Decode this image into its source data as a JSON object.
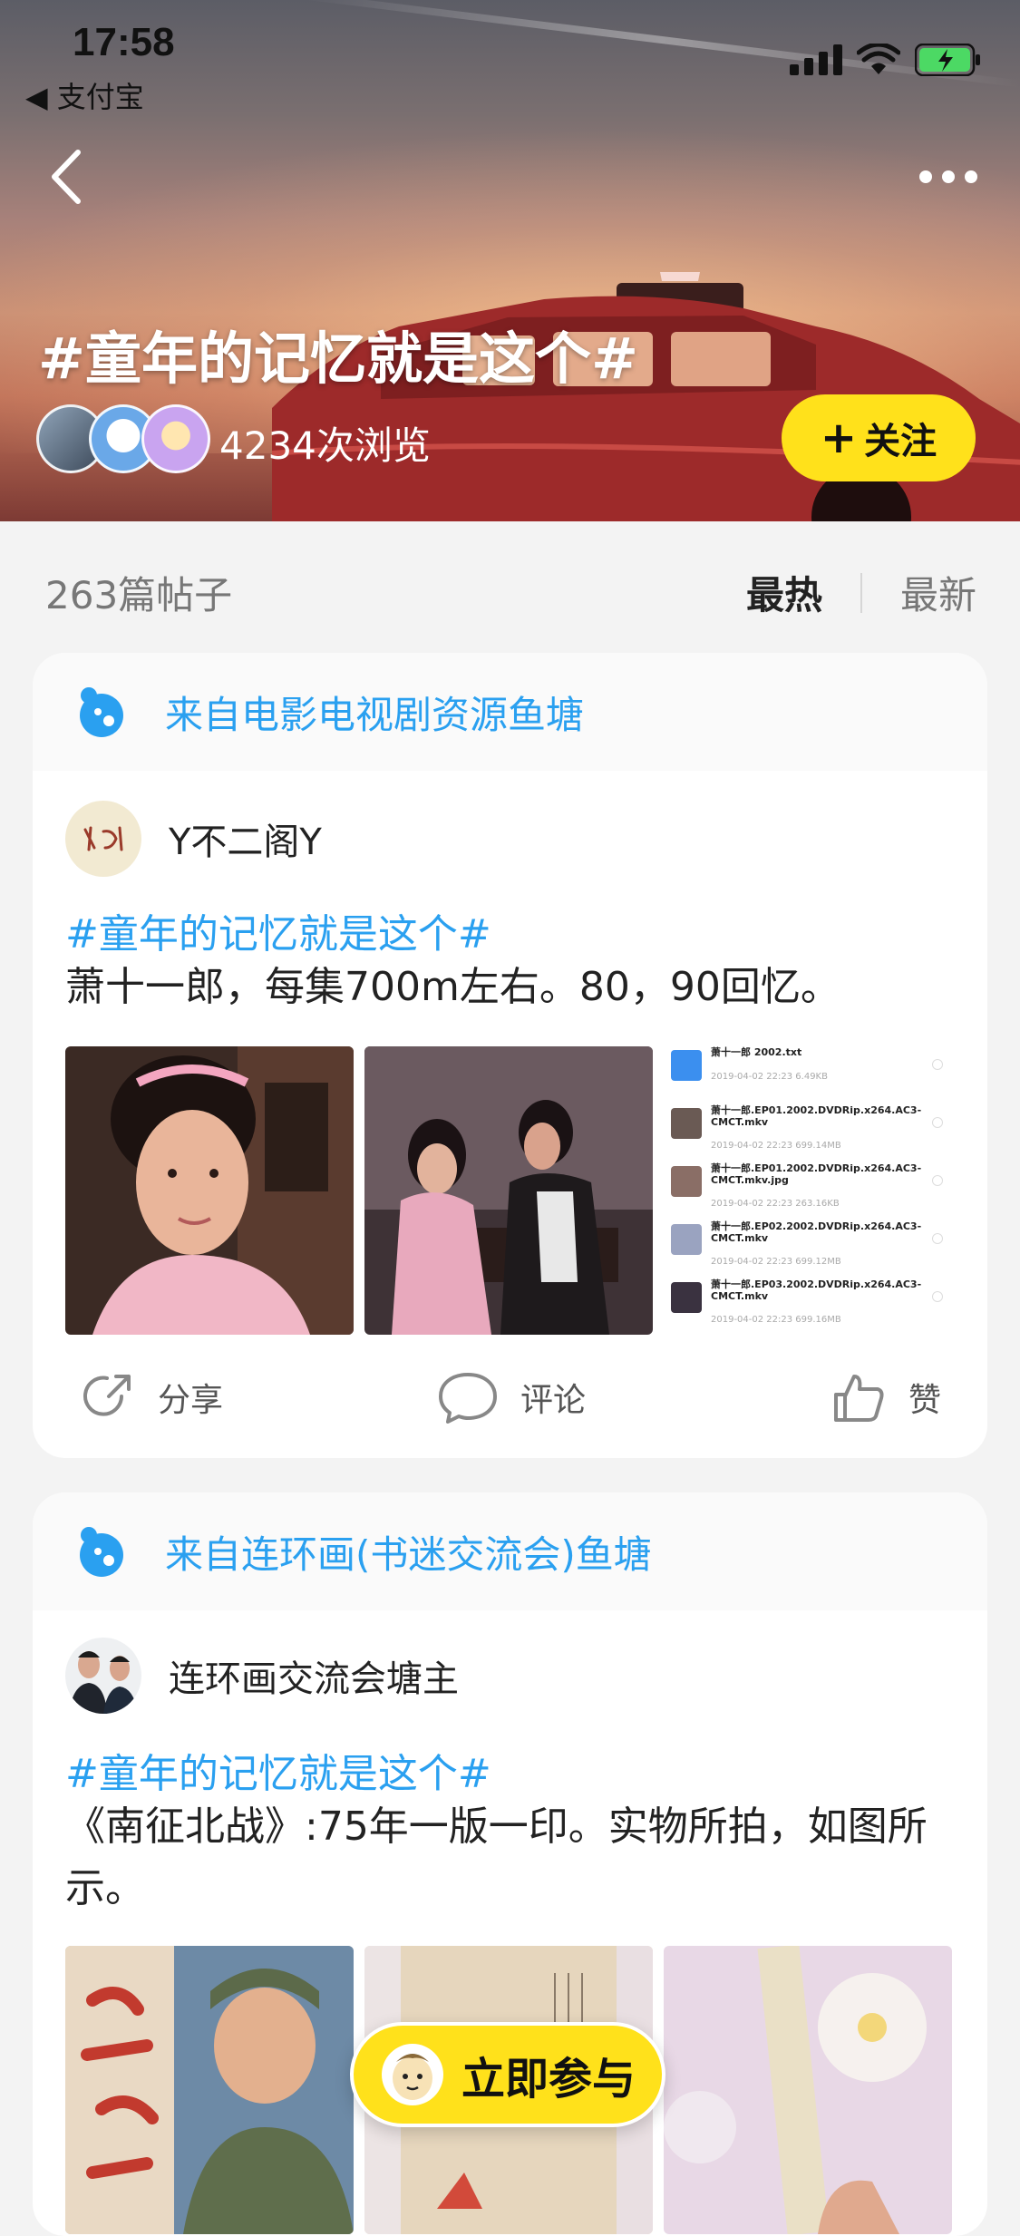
{
  "status_bar": {
    "time": "17:58",
    "back_app": "◀ 支付宝"
  },
  "header": {
    "title": "#童年的记忆就是这个#",
    "views": "4234次浏览",
    "follow_label": "关注"
  },
  "sort_bar": {
    "post_count": "263篇帖子",
    "hot": "最热",
    "newest": "最新"
  },
  "posts": [
    {
      "source": "来自电影电视剧资源鱼塘",
      "author": "Y不二阁Y",
      "hashtag": "#童年的记忆就是这个#",
      "text": "萧十一郎，每集700m左右。80，90回忆。",
      "files": [
        {
          "name": "萧十一郎 2002.txt",
          "meta": "2019-04-02  22:23  6.49KB"
        },
        {
          "name": "萧十一郎.EP01.2002.DVDRip.x264.AC3-CMCT.mkv",
          "meta": "2019-04-02  22:23  699.14MB"
        },
        {
          "name": "萧十一郎.EP01.2002.DVDRip.x264.AC3-CMCT.mkv.jpg",
          "meta": "2019-04-02  22:23  263.16KB"
        },
        {
          "name": "萧十一郎.EP02.2002.DVDRip.x264.AC3-CMCT.mkv",
          "meta": "2019-04-02  22:23  699.12MB"
        },
        {
          "name": "萧十一郎.EP03.2002.DVDRip.x264.AC3-CMCT.mkv",
          "meta": "2019-04-02  22:23  699.16MB"
        }
      ],
      "actions": {
        "share": "分享",
        "comment": "评论",
        "like": "赞"
      }
    },
    {
      "source": "来自连环画(书迷交流会)鱼塘",
      "author": "连环画交流会塘主",
      "hashtag": "#童年的记忆就是这个#",
      "text": "《南征北战》:75年一版一印。实物所拍，如图所示。"
    }
  ],
  "join_label": "立即参与",
  "colors": {
    "accent_yellow": "#ffe11b",
    "link_blue": "#2aa0f0"
  }
}
